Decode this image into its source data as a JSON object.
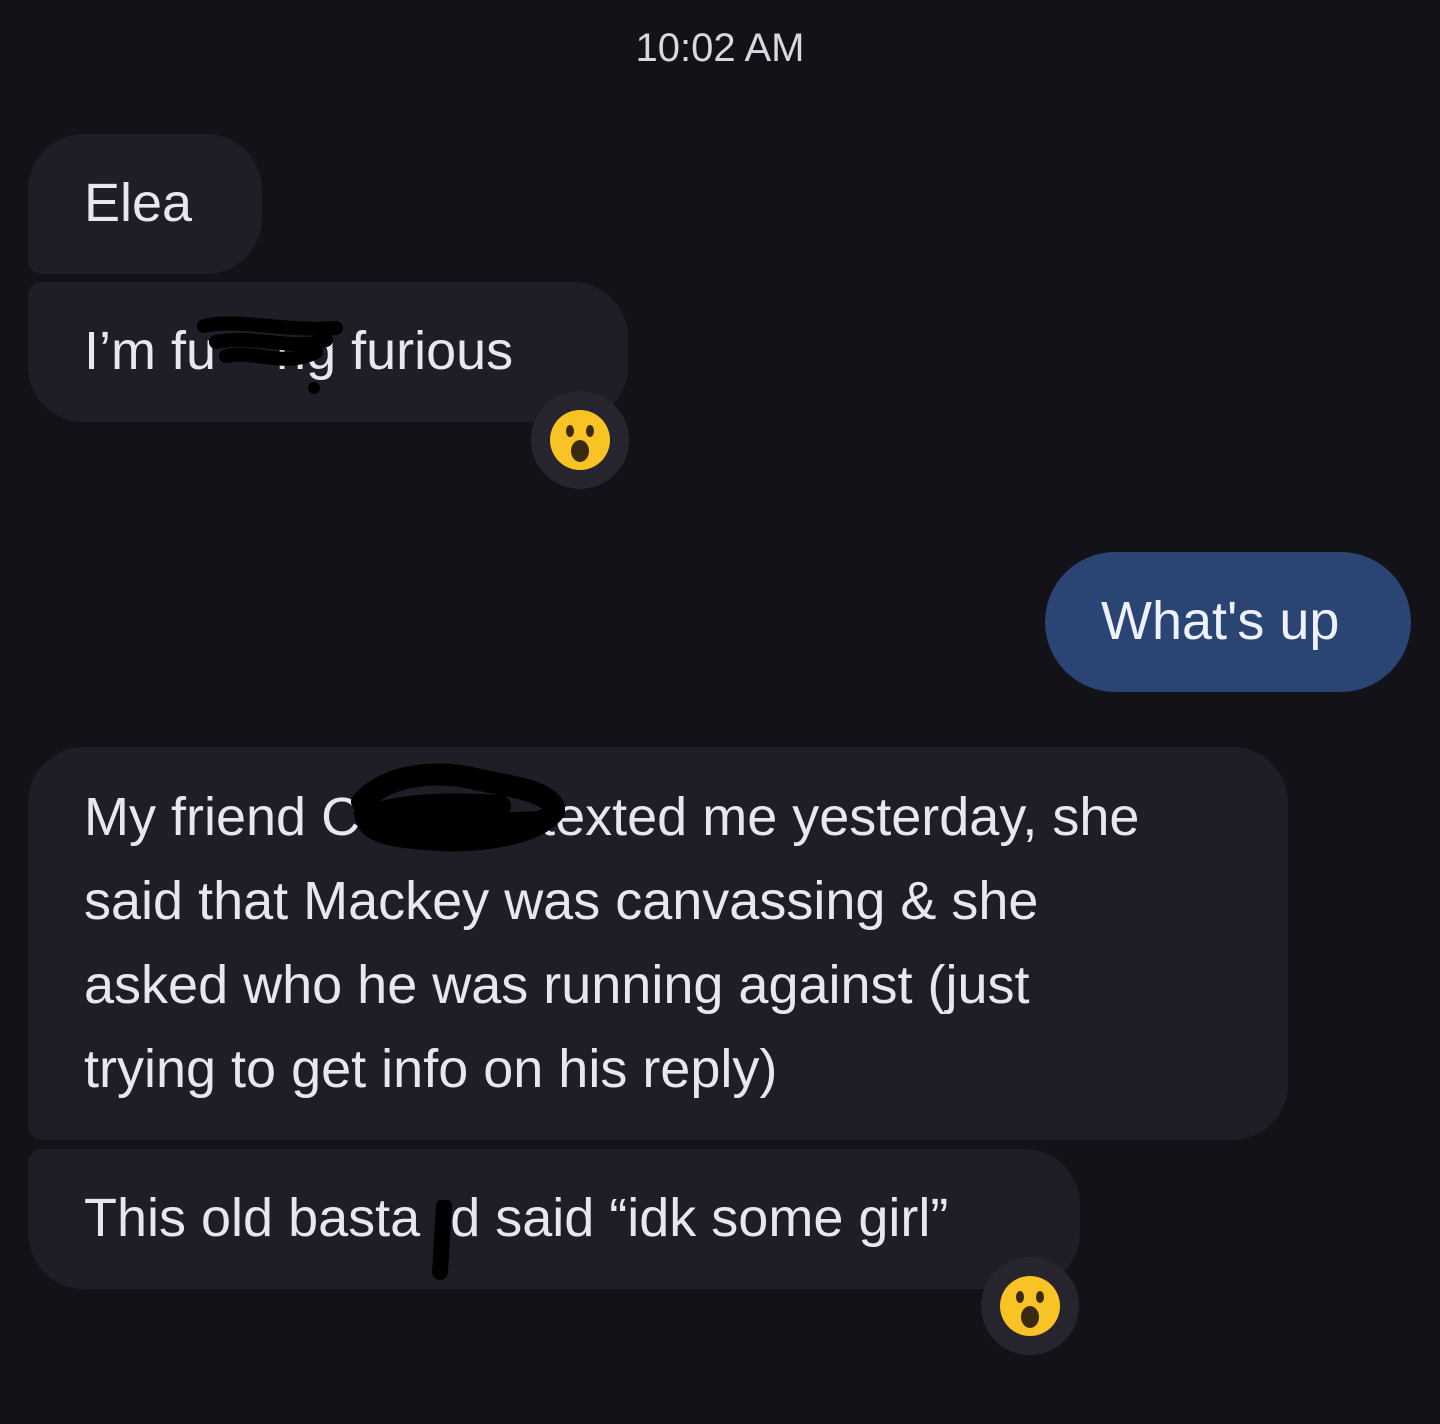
{
  "timestamp": "10:02 AM",
  "messages": [
    {
      "id": "m1",
      "direction": "incoming",
      "text": "Elea"
    },
    {
      "id": "m2",
      "direction": "incoming",
      "text": "I’m fu    ng furious",
      "reaction": "surprised-face"
    },
    {
      "id": "m3",
      "direction": "outgoing",
      "text": "What's up"
    },
    {
      "id": "m4",
      "direction": "incoming",
      "lines": [
        "My friend C            texted me yesterday, she",
        "said that Mackey was canvassing & she",
        "asked who he was running against (just",
        "trying to get info on his reply)"
      ]
    },
    {
      "id": "m5",
      "direction": "incoming",
      "text": "This old basta  d said “idk some girl”",
      "reaction": "surprised-face"
    }
  ],
  "colors": {
    "background": "#121218",
    "incoming_bubble": "#1f1e27",
    "outgoing_bubble": "#2a4473",
    "reaction_bg": "#26252d",
    "emoji_yellow": "#f7c325"
  }
}
